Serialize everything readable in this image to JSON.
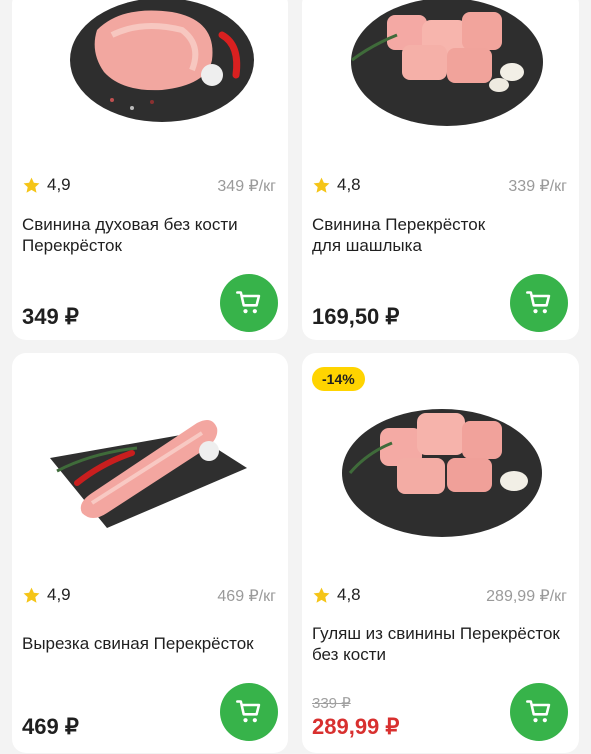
{
  "products": [
    {
      "rating": "4,9",
      "unit_price": "349 ₽/кг",
      "name_line1": "Свинина духовая без кости",
      "name_line2": "Перекрёсток",
      "price": "349 ₽",
      "old_price": "",
      "badge": ""
    },
    {
      "rating": "4,8",
      "unit_price": "339 ₽/кг",
      "name_line1": "Свинина Перекрёсток",
      "name_line2": "для шашлыка",
      "price": "169,50 ₽",
      "old_price": "",
      "badge": ""
    },
    {
      "rating": "4,9",
      "unit_price": "469 ₽/кг",
      "name_line1": "Вырезка свиная Перекрёсток",
      "name_line2": "",
      "price": "469 ₽",
      "old_price": "",
      "badge": ""
    },
    {
      "rating": "4,8",
      "unit_price": "289,99 ₽/кг",
      "name_line1": "Гуляш из свинины Перекрёсток",
      "name_line2": "без кости",
      "price": "289,99 ₽",
      "old_price": "339 ₽",
      "badge": "-14%"
    }
  ],
  "icons": {
    "rating": "star-icon",
    "cart": "cart-icon"
  },
  "colors": {
    "accent": "#37b34a",
    "sale": "#d8302f",
    "badge": "#ffd400",
    "star": "#f5c518"
  }
}
